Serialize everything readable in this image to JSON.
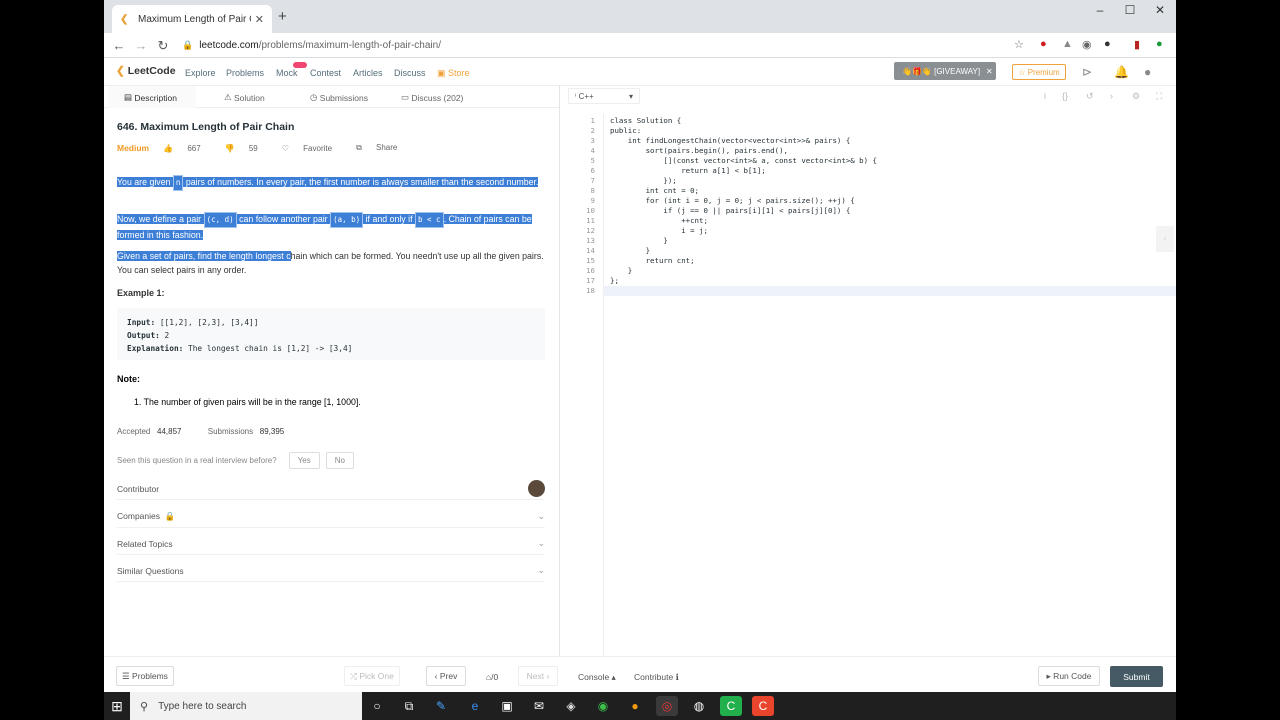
{
  "browser": {
    "tab_title": "Maximum Length of Pair Chain -",
    "tab_close": "✕",
    "new_tab": "+",
    "url_domain": "leetcode.com",
    "url_path": "/problems/maximum-length-of-pair-chain/",
    "minimize": "–",
    "maximize": "☐",
    "close": "✕"
  },
  "nav": {
    "logo": "LeetCode",
    "links": [
      "Explore",
      "Problems",
      "Mock",
      "Contest",
      "Articles",
      "Discuss"
    ],
    "store": "Store",
    "giveaway": "👋🎁👋 [GIVEAWAY]",
    "giveaway_close": "✕",
    "premium": "☆ Premium"
  },
  "left_tabs": [
    "Description",
    "Solution",
    "Submissions",
    "Discuss (202)"
  ],
  "question": {
    "title": "646. Maximum Length of Pair Chain",
    "difficulty": "Medium",
    "likes": "667",
    "dislikes": "59",
    "favorite": "Favorite",
    "share": "Share",
    "p1_a": "You are given ",
    "p1_code": "n",
    "p1_b": " pairs of numbers. In every pair, the first number is always smaller than the second number.",
    "p2_a": "Now, we define a pair ",
    "p2_code1": "(c, d)",
    "p2_b": " can follow another pair ",
    "p2_code2": "(a, b)",
    "p2_c": " if and only if ",
    "p2_code3": "b < c",
    "p2_d": ". Chain of pairs can be formed in this fashion.",
    "p3_hl": "Given a set of pairs, find the length longest c",
    "p3_rest": "hain which can be formed. You needn't use up all the given pairs. You can select pairs in any order.",
    "example_title": "Example 1:",
    "ex_input_label": "Input:",
    "ex_input": " [[1,2], [2,3], [3,4]]",
    "ex_output_label": "Output:",
    "ex_output": " 2",
    "ex_expl_label": "Explanation:",
    "ex_expl": " The longest chain is [1,2] -> [3,4]",
    "note_title": "Note:",
    "note_item": "1. The number of given pairs will be in the range [1, 1000].",
    "accepted_label": "Accepted",
    "accepted": "44,857",
    "submissions_label": "Submissions",
    "submissions": "89,395",
    "interview_q": "Seen this question in a real interview before?",
    "yes": "Yes",
    "no": "No",
    "contributor": "Contributor",
    "companies": "Companies",
    "related": "Related Topics",
    "similar": "Similar Questions"
  },
  "editor": {
    "language": "C++",
    "line_numbers": "1\n2\n3\n4\n5\n6\n7\n8\n9\n10\n11\n12\n13\n14\n15\n16\n17\n18",
    "code": "class Solution {\npublic:\n    int findLongestChain(vector<vector<int>>& pairs) {\n        sort(pairs.begin(), pairs.end(),\n            [](const vector<int>& a, const vector<int>& b) {\n                return a[1] < b[1];\n            });\n        int cnt = 0;\n        for (int i = 0, j = 0; j < pairs.size(); ++j) {\n            if (j == 0 || pairs[i][1] < pairs[j][0]) {\n                ++cnt;\n                i = j;\n            }\n        }\n        return cnt;\n    }\n};\n"
  },
  "footer": {
    "problems": "☰ Problems",
    "pick_one": "⤮ Pick One",
    "prev": "‹ Prev",
    "page": "⌂/0",
    "next": "Next ›",
    "console": "Console ▴",
    "contribute": "Contribute ℹ",
    "run_code": "▸ Run Code",
    "submit": "Submit"
  },
  "taskbar": {
    "search_placeholder": "Type here to search"
  }
}
